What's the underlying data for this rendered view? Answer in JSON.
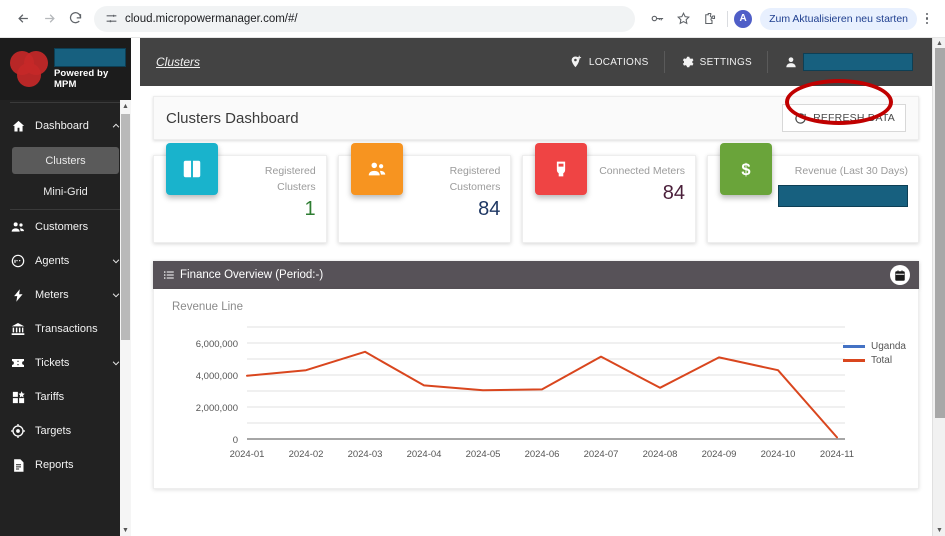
{
  "browser": {
    "back_icon": "back-arrow-icon",
    "forward_icon": "forward-arrow-icon",
    "reload_icon": "reload-icon",
    "url": "cloud.micropowermanager.com/#/",
    "site_settings_icon": "tune-icon",
    "password_icon": "key-icon",
    "bookmark_icon": "star-icon",
    "extensions_icon": "puzzle-icon",
    "profile_initial": "A",
    "update_button": "Zum Aktualisieren neu starten",
    "menu_icon": "kebab-menu-icon"
  },
  "sidebar": {
    "powered_by": "Powered by MPM",
    "logo_name": "mpm-venn-logo",
    "items": [
      {
        "label": "Dashboard",
        "icon": "home-icon",
        "caret": "chevron-up-icon"
      },
      {
        "label": "Customers",
        "icon": "people-icon",
        "caret": ""
      },
      {
        "label": "Agents",
        "icon": "agent-headset-icon",
        "caret": "chevron-down-icon"
      },
      {
        "label": "Meters",
        "icon": "bolt-icon",
        "caret": "chevron-down-icon"
      },
      {
        "label": "Transactions",
        "icon": "bank-icon",
        "caret": ""
      },
      {
        "label": "Tickets",
        "icon": "ticket-icon",
        "caret": "chevron-down-icon"
      },
      {
        "label": "Tariffs",
        "icon": "grid-blocks-icon",
        "caret": ""
      },
      {
        "label": "Targets",
        "icon": "target-icon",
        "caret": ""
      },
      {
        "label": "Reports",
        "icon": "document-icon",
        "caret": ""
      }
    ],
    "sub_items": [
      {
        "label": "Clusters",
        "active": true
      },
      {
        "label": "Mini-Grid",
        "active": false
      }
    ]
  },
  "topbar": {
    "breadcrumb": "Clusters",
    "locations_label": "LOCATIONS",
    "locations_icon": "add-location-icon",
    "settings_label": "SETTINGS",
    "settings_icon": "gear-icon",
    "user_icon": "person-icon"
  },
  "header": {
    "title": "Clusters Dashboard",
    "refresh_label": "REFRESH DATA",
    "refresh_icon": "refresh-icon"
  },
  "cards": [
    {
      "label": "Registered Clusters",
      "value": "1",
      "icon": "map-book-icon",
      "color": "#19b3cc",
      "value_color": "#2e7d32",
      "redacted": false
    },
    {
      "label": "Registered Customers",
      "value": "84",
      "icon": "people-icon",
      "color": "#f79420",
      "value_color": "#1f3864",
      "redacted": false
    },
    {
      "label": "Connected Meters",
      "value": "84",
      "icon": "meter-icon",
      "color": "#ef4444",
      "value_color": "#4a1f3a",
      "redacted": false
    },
    {
      "label": "Revenue (Last 30 Days)",
      "value": "",
      "icon": "dollar-icon",
      "color": "#6aa43a",
      "value_color": "#17607f",
      "redacted": true
    }
  ],
  "panel": {
    "title": "Finance Overview (Period:-)",
    "list_icon": "list-icon",
    "calendar_icon": "calendar-icon"
  },
  "chart_data": {
    "type": "line",
    "title": "Revenue Line",
    "xlabel": "",
    "ylabel": "",
    "x": [
      "2024-01",
      "2024-02",
      "2024-03",
      "2024-04",
      "2024-05",
      "2024-06",
      "2024-07",
      "2024-08",
      "2024-09",
      "2024-10",
      "2024-11"
    ],
    "ytick_labels": [
      "0",
      "2,000,000",
      "4,000,000",
      "6,000,000"
    ],
    "yticks": [
      0,
      2000000,
      4000000,
      6000000
    ],
    "ylim": [
      0,
      7000000
    ],
    "grid": true,
    "gridline_step": 1000000,
    "legend_position": "right",
    "series": [
      {
        "name": "Uganda",
        "color": "#4472c4",
        "values": []
      },
      {
        "name": "Total",
        "color": "#d9461e",
        "values": [
          3950000,
          4300000,
          5450000,
          3350000,
          3050000,
          3100000,
          5150000,
          3200000,
          5100000,
          4300000,
          100000
        ]
      }
    ]
  },
  "annotation": {
    "shape": "red-ellipse-highlight",
    "target": "LOCATIONS"
  }
}
